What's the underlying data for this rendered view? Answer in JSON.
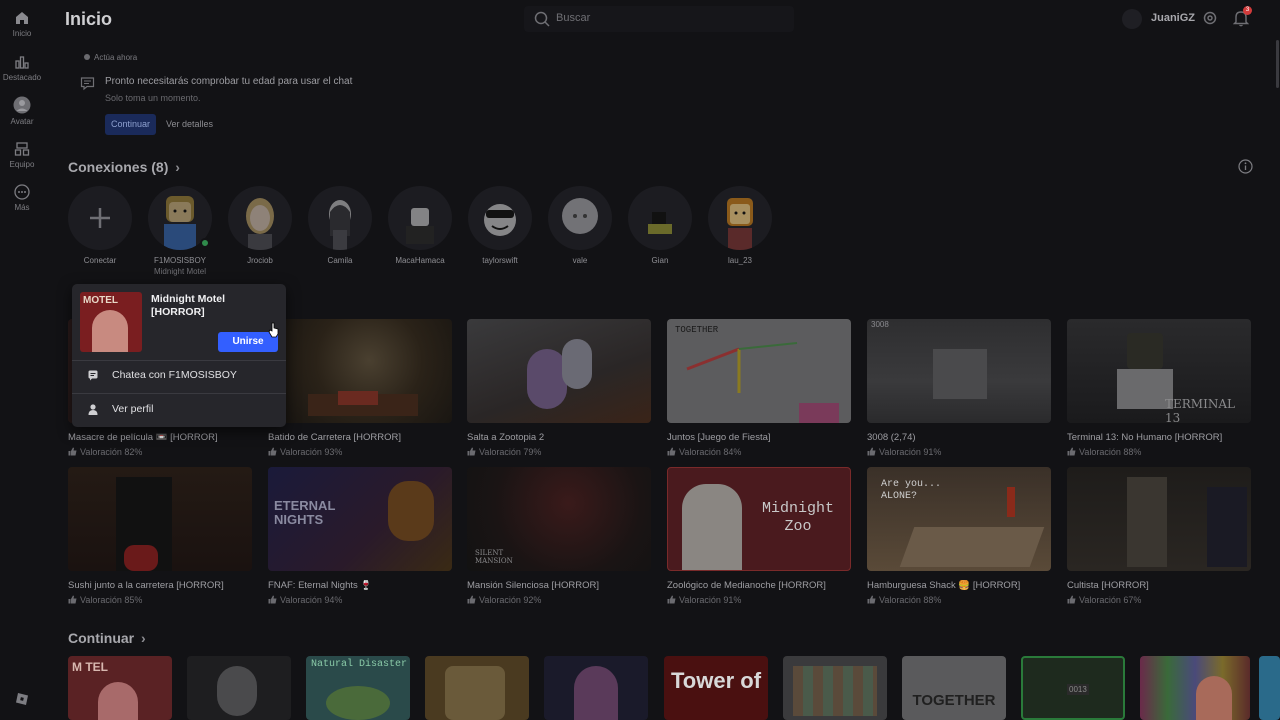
{
  "sidebar": {
    "items": [
      {
        "label": "Inicio",
        "icon": "home-icon"
      },
      {
        "label": "Destacado",
        "icon": "chart-icon"
      },
      {
        "label": "Avatar",
        "icon": "avatar-icon"
      },
      {
        "label": "Equipo",
        "icon": "team-icon"
      },
      {
        "label": "Más",
        "icon": "more-icon"
      }
    ]
  },
  "header": {
    "title": "Inicio",
    "search_placeholder": "Buscar",
    "username": "JuaniGZ",
    "notification_count": "3"
  },
  "notice": {
    "tag": "Actúa ahora",
    "title": "Pronto necesitarás comprobar tu edad para usar el chat",
    "subtitle": "Solo toma un momento.",
    "continue_label": "Continuar",
    "details_label": "Ver detalles"
  },
  "connections": {
    "title": "Conexiones (8)",
    "items": [
      {
        "name": "Conectar",
        "sub": ""
      },
      {
        "name": "F1MOSISBOY",
        "sub": "Midnight Motel"
      },
      {
        "name": "Jrociob",
        "sub": ""
      },
      {
        "name": "Camila",
        "sub": ""
      },
      {
        "name": "MacaHamaca",
        "sub": ""
      },
      {
        "name": "taylorswift",
        "sub": ""
      },
      {
        "name": "vale",
        "sub": ""
      },
      {
        "name": "Gian",
        "sub": ""
      },
      {
        "name": "lau_23",
        "sub": ""
      }
    ]
  },
  "games": {
    "row1": [
      {
        "title": "Masacre de película 📼 [HORROR]",
        "rating": "Valoración 82%"
      },
      {
        "title": "Batido de Carretera [HORROR]",
        "rating": "Valoración 93%"
      },
      {
        "title": "Salta a Zootopia 2",
        "rating": "Valoración 79%"
      },
      {
        "title": "Juntos [Juego de Fiesta]",
        "rating": "Valoración 84%"
      },
      {
        "title": "3008 (2,74)",
        "rating": "Valoración 91%"
      },
      {
        "title": "Terminal 13: No Humano [HORROR]",
        "rating": "Valoración 88%"
      }
    ],
    "row2": [
      {
        "title": "Sushi junto a la carretera [HORROR]",
        "rating": "Valoración 85%"
      },
      {
        "title": "FNAF: Eternal Nights 🍷",
        "rating": "Valoración 94%"
      },
      {
        "title": "Mansión Silenciosa [HORROR]",
        "rating": "Valoración 92%"
      },
      {
        "title": "Zoológico de Medianoche [HORROR]",
        "rating": "Valoración 91%"
      },
      {
        "title": "Hamburguesa Shack 🍔 [HORROR]",
        "rating": "Valoración 88%"
      },
      {
        "title": "Cultista [HORROR]",
        "rating": "Valoración 67%"
      }
    ],
    "thumb_text": {
      "juntos": "TOGETHER",
      "g3008": "3008",
      "terminal": "TERMINAL 13",
      "eternal": "ETERNAL NIGHTS",
      "silent": "SILENT MANSION",
      "zoo": "Midnight Zoo",
      "burger": "Are you... ALONE?"
    }
  },
  "continue_section": {
    "title": "Continuar",
    "thumb_text": {
      "natural": "Natural Disaster",
      "tower": "Tower of",
      "together": "TOGETHER",
      "motel": "M TEL",
      "number": "0013"
    }
  },
  "popup": {
    "game_title": "Midnight Motel [HORROR]",
    "thumb_text": "MOTEL",
    "join_label": "Unirse",
    "chat_label": "Chatea con F1MOSISBOY",
    "profile_label": "Ver perfil"
  }
}
